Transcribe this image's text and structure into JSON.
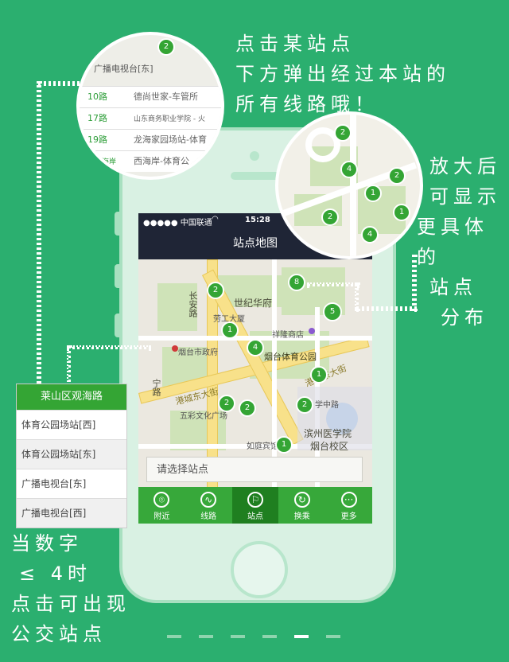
{
  "annotations": {
    "top_right": [
      "点击某站点",
      "下方弹出经过本站的",
      "所有线路哦！"
    ],
    "right": [
      "放大后",
      "可显示",
      "更具体的",
      "站点",
      "分布"
    ],
    "bottom_left": [
      "当数字",
      "≤ 4时",
      "点击可出现",
      "公交站点"
    ]
  },
  "status_bar": {
    "carrier": "●●●●● 中国联通",
    "time": "15:28"
  },
  "nav": {
    "title": "站点地图"
  },
  "map": {
    "labels": {
      "changan_road": "长安路",
      "century": "世纪华府",
      "labor": "劳工大厦",
      "xianglong": "祥隆商店",
      "gov": "烟台市政府",
      "stadium": "烟台体育公园",
      "gangcheng": "港城东大街",
      "gangcheng2": "港城东大街",
      "wucai": "五彩文化广场",
      "ningyu": "宁路",
      "ruting": "如庭宾馆",
      "binzhou": "滨州医学院",
      "yantai_campus": "烟台校区",
      "xuezhong": "学中路"
    },
    "pins": [
      "2",
      "1",
      "4",
      "8",
      "5",
      "1",
      "2",
      "2",
      "2",
      "1"
    ]
  },
  "search": {
    "placeholder": "请选择站点"
  },
  "tabs": [
    {
      "label": "附近",
      "icon": "location-icon"
    },
    {
      "label": "线路",
      "icon": "route-icon"
    },
    {
      "label": "站点",
      "icon": "flag-icon"
    },
    {
      "label": "换乘",
      "icon": "transfer-icon"
    },
    {
      "label": "更多",
      "icon": "more-icon"
    }
  ],
  "zoom_list": {
    "pin": "2",
    "header": "广播电视台[东]",
    "rows": [
      {
        "route": "10路",
        "name": "德尚世家-车管所"
      },
      {
        "route": "17路",
        "name": "山东商务职业学院 - 火"
      },
      {
        "route": "19路",
        "name": "龙海家园场站-体育"
      },
      {
        "route": "路西海岸",
        "name": "西海岸-体育公"
      }
    ]
  },
  "zoom_map": {
    "pins": [
      "2",
      "4",
      "2",
      "1",
      "1",
      "2",
      "4"
    ]
  },
  "station_card": {
    "title": "莱山区观海路",
    "rows": [
      "体育公园场站[西]",
      "体育公园场站[东]",
      "广播电视台[东]",
      "广播电视台[西]"
    ]
  },
  "colors": {
    "background": "#2baf6f",
    "accent": "#34a534",
    "nav": "#1f2536"
  }
}
